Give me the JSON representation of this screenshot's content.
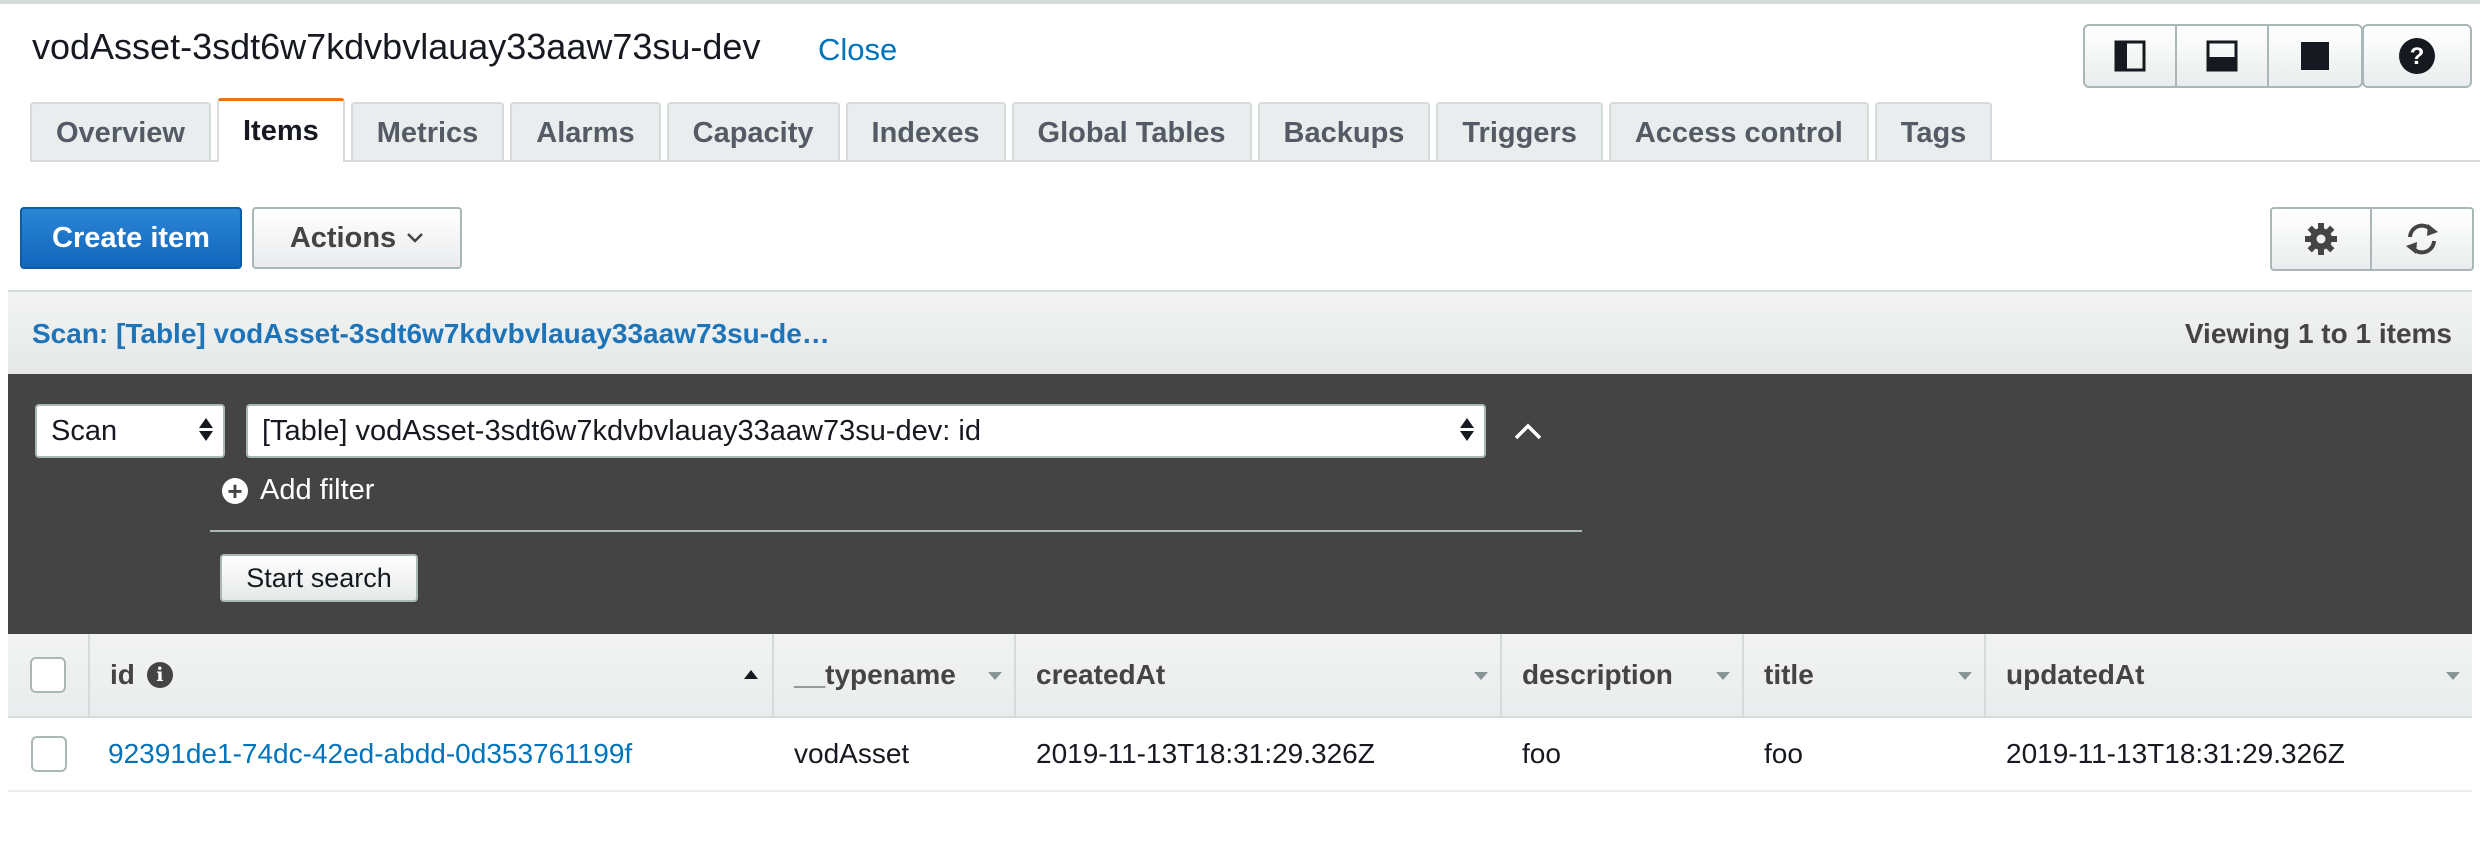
{
  "header": {
    "title": "vodAsset-3sdt6w7kdvbvlauay33aaw73su-dev",
    "close_label": "Close",
    "view_buttons": [
      "split-right-view-icon",
      "split-bottom-view-icon",
      "full-view-icon"
    ],
    "help_icon": "question-icon"
  },
  "tabs": [
    {
      "label": "Overview",
      "active": false
    },
    {
      "label": "Items",
      "active": true
    },
    {
      "label": "Metrics",
      "active": false
    },
    {
      "label": "Alarms",
      "active": false
    },
    {
      "label": "Capacity",
      "active": false
    },
    {
      "label": "Indexes",
      "active": false
    },
    {
      "label": "Global Tables",
      "active": false
    },
    {
      "label": "Backups",
      "active": false
    },
    {
      "label": "Triggers",
      "active": false
    },
    {
      "label": "Access control",
      "active": false
    },
    {
      "label": "Tags",
      "active": false
    }
  ],
  "toolbar": {
    "create_label": "Create item",
    "actions_label": "Actions",
    "settings_icon": "gear-icon",
    "refresh_icon": "refresh-icon"
  },
  "scan_bar": {
    "title": "Scan: [Table] vodAsset-3sdt6w7kdvbvlauay33aaw73su-de…",
    "viewing": "Viewing 1 to 1 items"
  },
  "scan_panel": {
    "mode": "Scan",
    "target": "[Table] vodAsset-3sdt6w7kdvbvlauay33aaw73su-dev: id",
    "add_filter_label": "Add filter",
    "start_label": "Start search"
  },
  "table": {
    "columns": [
      "id",
      "__typename",
      "createdAt",
      "description",
      "title",
      "updatedAt"
    ],
    "sorted_column": "id",
    "rows": [
      {
        "id": "92391de1-74dc-42ed-abdd-0d353761199f",
        "typename": "vodAsset",
        "createdAt": "2019-11-13T18:31:29.326Z",
        "description": "foo",
        "title": "foo",
        "updatedAt": "2019-11-13T18:31:29.326Z"
      }
    ]
  },
  "colors": {
    "accent": "#0073bb",
    "primary_button": "#1166bb",
    "active_tab_border": "#ec7211",
    "scan_panel_bg": "#444444"
  }
}
